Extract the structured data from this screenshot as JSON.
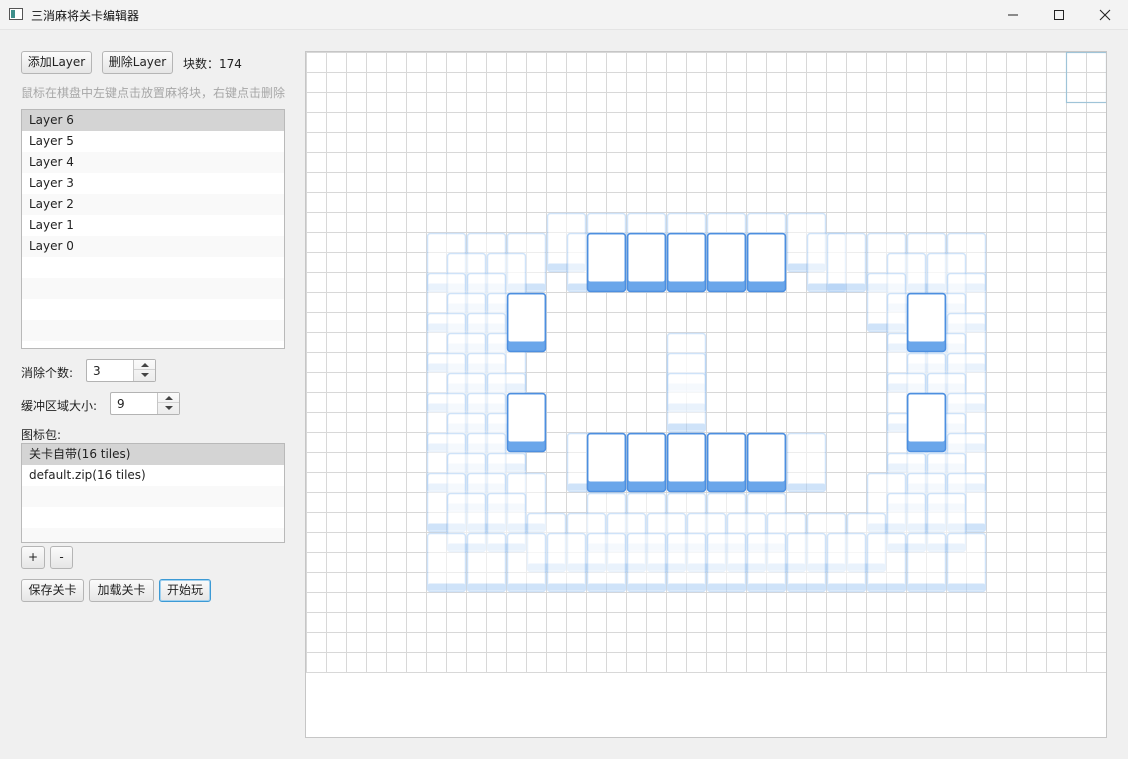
{
  "window": {
    "title": "三消麻将关卡编辑器",
    "controls": [
      "minimize",
      "maximize",
      "close"
    ]
  },
  "toolbar": {
    "add_layer": "添加Layer",
    "delete_layer": "删除Layer",
    "block_count_label": "块数：174"
  },
  "hint": "鼠标在棋盘中左键点击放置麻将块，右键点击删除",
  "layers": {
    "items": [
      "Layer 6",
      "Layer 5",
      "Layer 4",
      "Layer 3",
      "Layer 2",
      "Layer 1",
      "Layer 0"
    ],
    "selected": "Layer 6"
  },
  "settings": {
    "eliminate_label": "消除个数:",
    "eliminate_value": "3",
    "buffer_label": "缓冲区域大小:",
    "buffer_value": "9"
  },
  "icon_pack": {
    "label": "图标包:",
    "items": [
      "关卡自带(16 tiles)",
      "default.zip(16 tiles)"
    ],
    "selected": "关卡自带(16 tiles)",
    "add": "+",
    "remove": "-"
  },
  "actions": {
    "save": "保存关卡",
    "load": "加载关卡",
    "play": "开始玩"
  },
  "board": {
    "columns": 40,
    "rows": 31,
    "highlight_cell": [
      38,
      0
    ],
    "colors": {
      "grid": "#d8d8d8",
      "tile_fill": "#ffffff",
      "tile_edge": "#6aa6ea",
      "tile_edge_dark": "#4d8fe0",
      "tile_ghost": "#a9cdf5",
      "highlight": "#9fc4d8"
    },
    "top_tiles": [
      [
        14,
        9
      ],
      [
        16,
        9
      ],
      [
        18,
        9
      ],
      [
        20,
        9
      ],
      [
        22,
        9
      ],
      [
        10,
        12
      ],
      [
        30,
        12
      ],
      [
        10,
        17
      ],
      [
        30,
        17
      ],
      [
        14,
        19
      ],
      [
        16,
        19
      ],
      [
        18,
        19
      ],
      [
        20,
        19
      ],
      [
        22,
        19
      ]
    ],
    "ghost_tiles": [
      [
        12,
        8
      ],
      [
        14,
        8
      ],
      [
        16,
        8
      ],
      [
        18,
        8
      ],
      [
        20,
        8
      ],
      [
        22,
        8
      ],
      [
        24,
        8
      ],
      [
        13,
        9
      ],
      [
        25,
        9
      ],
      [
        6,
        9
      ],
      [
        8,
        9
      ],
      [
        10,
        9
      ],
      [
        26,
        9
      ],
      [
        28,
        9
      ],
      [
        30,
        9
      ],
      [
        32,
        9
      ],
      [
        7,
        10
      ],
      [
        9,
        10
      ],
      [
        29,
        10
      ],
      [
        31,
        10
      ],
      [
        6,
        11
      ],
      [
        8,
        11
      ],
      [
        28,
        11
      ],
      [
        32,
        11
      ],
      [
        7,
        12
      ],
      [
        9,
        12
      ],
      [
        29,
        12
      ],
      [
        31,
        12
      ],
      [
        6,
        13
      ],
      [
        8,
        13
      ],
      [
        30,
        13
      ],
      [
        32,
        13
      ],
      [
        7,
        14
      ],
      [
        9,
        14
      ],
      [
        29,
        14
      ],
      [
        31,
        14
      ],
      [
        6,
        15
      ],
      [
        8,
        15
      ],
      [
        18,
        14
      ],
      [
        18,
        15
      ],
      [
        18,
        16
      ],
      [
        30,
        15
      ],
      [
        32,
        15
      ],
      [
        7,
        16
      ],
      [
        9,
        16
      ],
      [
        29,
        16
      ],
      [
        31,
        16
      ],
      [
        6,
        17
      ],
      [
        8,
        17
      ],
      [
        30,
        17
      ],
      [
        32,
        17
      ],
      [
        7,
        18
      ],
      [
        9,
        18
      ],
      [
        29,
        18
      ],
      [
        31,
        18
      ],
      [
        6,
        19
      ],
      [
        8,
        19
      ],
      [
        13,
        19
      ],
      [
        24,
        19
      ],
      [
        30,
        19
      ],
      [
        32,
        19
      ],
      [
        7,
        20
      ],
      [
        9,
        20
      ],
      [
        29,
        20
      ],
      [
        31,
        20
      ],
      [
        6,
        21
      ],
      [
        8,
        21
      ],
      [
        10,
        21
      ],
      [
        14,
        22
      ],
      [
        16,
        22
      ],
      [
        18,
        22
      ],
      [
        20,
        22
      ],
      [
        22,
        22
      ],
      [
        28,
        21
      ],
      [
        30,
        21
      ],
      [
        32,
        21
      ],
      [
        7,
        22
      ],
      [
        9,
        22
      ],
      [
        11,
        23
      ],
      [
        13,
        23
      ],
      [
        15,
        23
      ],
      [
        17,
        23
      ],
      [
        19,
        23
      ],
      [
        21,
        23
      ],
      [
        23,
        23
      ],
      [
        25,
        23
      ],
      [
        27,
        23
      ],
      [
        29,
        22
      ],
      [
        31,
        22
      ],
      [
        6,
        24
      ],
      [
        8,
        24
      ],
      [
        10,
        24
      ],
      [
        12,
        24
      ],
      [
        14,
        24
      ],
      [
        16,
        24
      ],
      [
        18,
        24
      ],
      [
        20,
        24
      ],
      [
        22,
        24
      ],
      [
        24,
        24
      ],
      [
        26,
        24
      ],
      [
        28,
        24
      ],
      [
        30,
        24
      ],
      [
        32,
        24
      ]
    ]
  }
}
